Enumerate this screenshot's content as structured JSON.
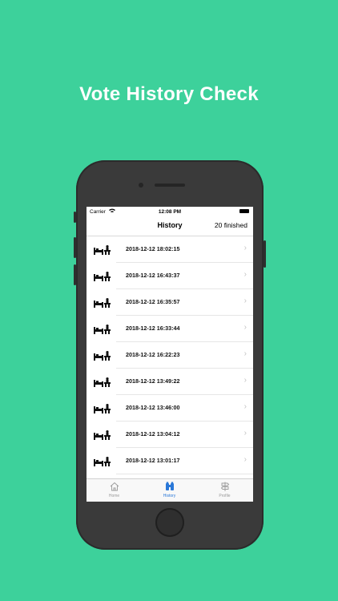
{
  "promo": {
    "title": "Vote History Check"
  },
  "status_bar": {
    "carrier": "Carrier",
    "time": "12:08 PM"
  },
  "nav": {
    "title": "History",
    "right_text": "20 finished"
  },
  "history": [
    "2018-12-12 18:02:15",
    "2018-12-12 16:43:37",
    "2018-12-12 16:35:57",
    "2018-12-12 16:33:44",
    "2018-12-12 16:22:23",
    "2018-12-12 13:49:22",
    "2018-12-12 13:46:00",
    "2018-12-12 13:04:12",
    "2018-12-12 13:01:17"
  ],
  "tabs": [
    {
      "label": "Home",
      "icon": "house-icon",
      "active": false
    },
    {
      "label": "History",
      "icon": "binoculars-icon",
      "active": true
    },
    {
      "label": "Profile",
      "icon": "signpost-icon",
      "active": false
    }
  ],
  "colors": {
    "background": "#3dd19b",
    "tab_active": "#2a78d8"
  }
}
